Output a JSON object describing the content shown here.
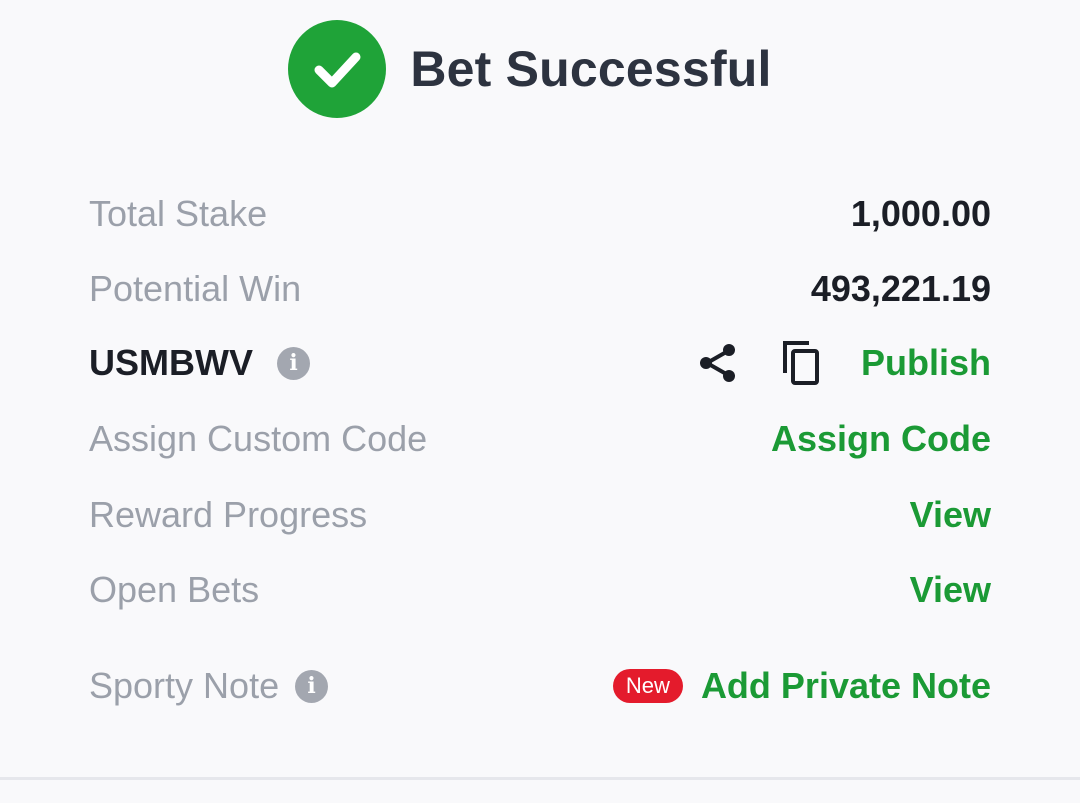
{
  "header": {
    "title": "Bet Successful",
    "icon": "check-circle-icon"
  },
  "summary": {
    "total_stake_label": "Total Stake",
    "total_stake_value": "1,000.00",
    "potential_win_label": "Potential Win",
    "potential_win_value": "493,221.19"
  },
  "booking": {
    "code": "USMBWV",
    "info_icon": "info-icon",
    "share_icon": "share-icon",
    "copy_icon": "copy-icon",
    "publish_label": "Publish"
  },
  "custom_code": {
    "label": "Assign Custom Code",
    "action": "Assign Code"
  },
  "reward_progress": {
    "label": "Reward Progress",
    "action": "View"
  },
  "open_bets": {
    "label": "Open Bets",
    "action": "View"
  },
  "sporty_note": {
    "label": "Sporty Note",
    "badge": "New",
    "action": "Add Private Note"
  },
  "colors": {
    "accent_green": "#1b9a35",
    "check_green": "#1fa338",
    "badge_red": "#e41b2c"
  }
}
